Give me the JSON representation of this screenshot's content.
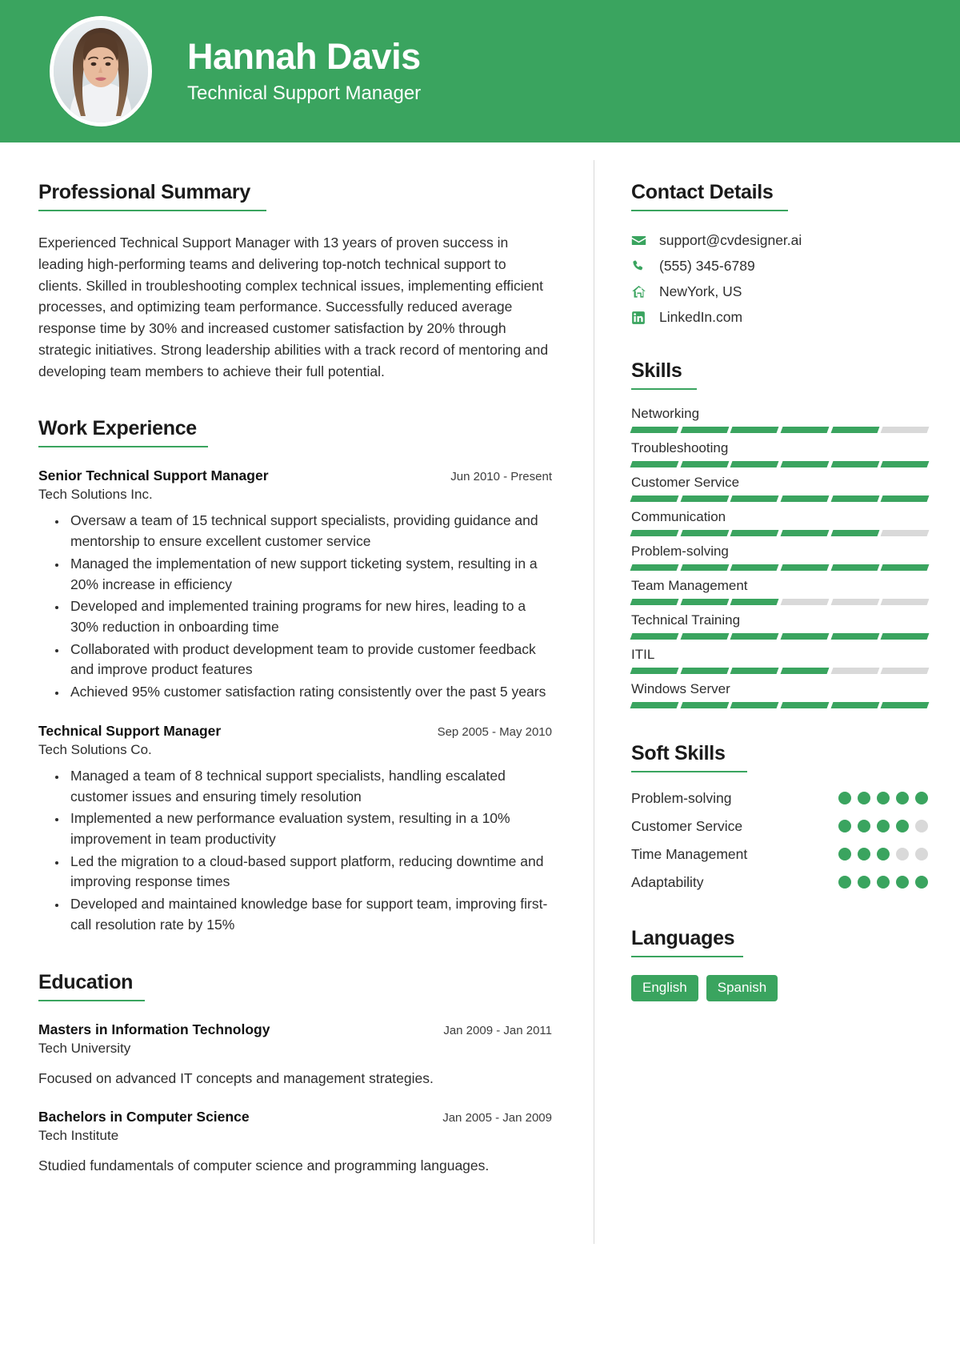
{
  "theme": {
    "accent": "#3aa45f",
    "accent_muted": "#d9d9d9",
    "text": "#2e2e2e"
  },
  "header": {
    "name": "Hannah Davis",
    "role": "Technical Support Manager",
    "avatar_icon": "profile-photo"
  },
  "summary": {
    "title": "Professional Summary",
    "text": "Experienced Technical Support Manager with 13 years of proven success in leading high-performing teams and delivering top-notch technical support to clients. Skilled in troubleshooting complex technical issues, implementing efficient processes, and optimizing team performance. Successfully reduced average response time by 30% and increased customer satisfaction by 20% through strategic initiatives. Strong leadership abilities with a track record of mentoring and developing team members to achieve their full potential."
  },
  "work": {
    "title": "Work Experience",
    "entries": [
      {
        "title": "Senior Technical Support Manager",
        "org": "Tech Solutions Inc.",
        "date": "Jun 2010 - Present",
        "bullets": [
          "Oversaw a team of 15 technical support specialists, providing guidance and mentorship to ensure excellent customer service",
          "Managed the implementation of new support ticketing system, resulting in a 20% increase in efficiency",
          "Developed and implemented training programs for new hires, leading to a 30% reduction in onboarding time",
          "Collaborated with product development team to provide customer feedback and improve product features",
          "Achieved 95% customer satisfaction rating consistently over the past 5 years"
        ]
      },
      {
        "title": "Technical Support Manager",
        "org": "Tech Solutions Co.",
        "date": "Sep 2005 - May 2010",
        "bullets": [
          "Managed a team of 8 technical support specialists, handling escalated customer issues and ensuring timely resolution",
          "Implemented a new performance evaluation system, resulting in a 10% improvement in team productivity",
          "Led the migration to a cloud-based support platform, reducing downtime and improving response times",
          "Developed and maintained knowledge base for support team, improving first-call resolution rate by 15%"
        ]
      }
    ]
  },
  "education": {
    "title": "Education",
    "entries": [
      {
        "title": "Masters in Information Technology",
        "org": "Tech University",
        "date": "Jan 2009 - Jan 2011",
        "desc": "Focused on advanced IT concepts and management strategies."
      },
      {
        "title": "Bachelors in Computer Science",
        "org": "Tech Institute",
        "date": "Jan 2005 - Jan 2009",
        "desc": "Studied fundamentals of computer science and programming languages."
      }
    ]
  },
  "contact": {
    "title": "Contact Details",
    "items": [
      {
        "icon": "envelope-icon",
        "value": "support@cvdesigner.ai"
      },
      {
        "icon": "phone-icon",
        "value": "(555) 345-6789"
      },
      {
        "icon": "home-icon",
        "value": "NewYork, US"
      },
      {
        "icon": "linkedin-icon",
        "value": "LinkedIn.com"
      }
    ]
  },
  "skills": {
    "title": "Skills",
    "segments_total": 6,
    "items": [
      {
        "name": "Networking",
        "filled": 5
      },
      {
        "name": "Troubleshooting",
        "filled": 6
      },
      {
        "name": "Customer Service",
        "filled": 6
      },
      {
        "name": "Communication",
        "filled": 5
      },
      {
        "name": "Problem-solving",
        "filled": 6
      },
      {
        "name": "Team Management",
        "filled": 3
      },
      {
        "name": "Technical Training",
        "filled": 6
      },
      {
        "name": "ITIL",
        "filled": 4
      },
      {
        "name": "Windows Server",
        "filled": 6
      }
    ]
  },
  "soft_skills": {
    "title": "Soft Skills",
    "dots_total": 5,
    "items": [
      {
        "name": "Problem-solving",
        "filled": 5
      },
      {
        "name": "Customer Service",
        "filled": 4
      },
      {
        "name": "Time Management",
        "filled": 3
      },
      {
        "name": "Adaptability",
        "filled": 5
      }
    ]
  },
  "languages": {
    "title": "Languages",
    "items": [
      "English",
      "Spanish"
    ]
  }
}
